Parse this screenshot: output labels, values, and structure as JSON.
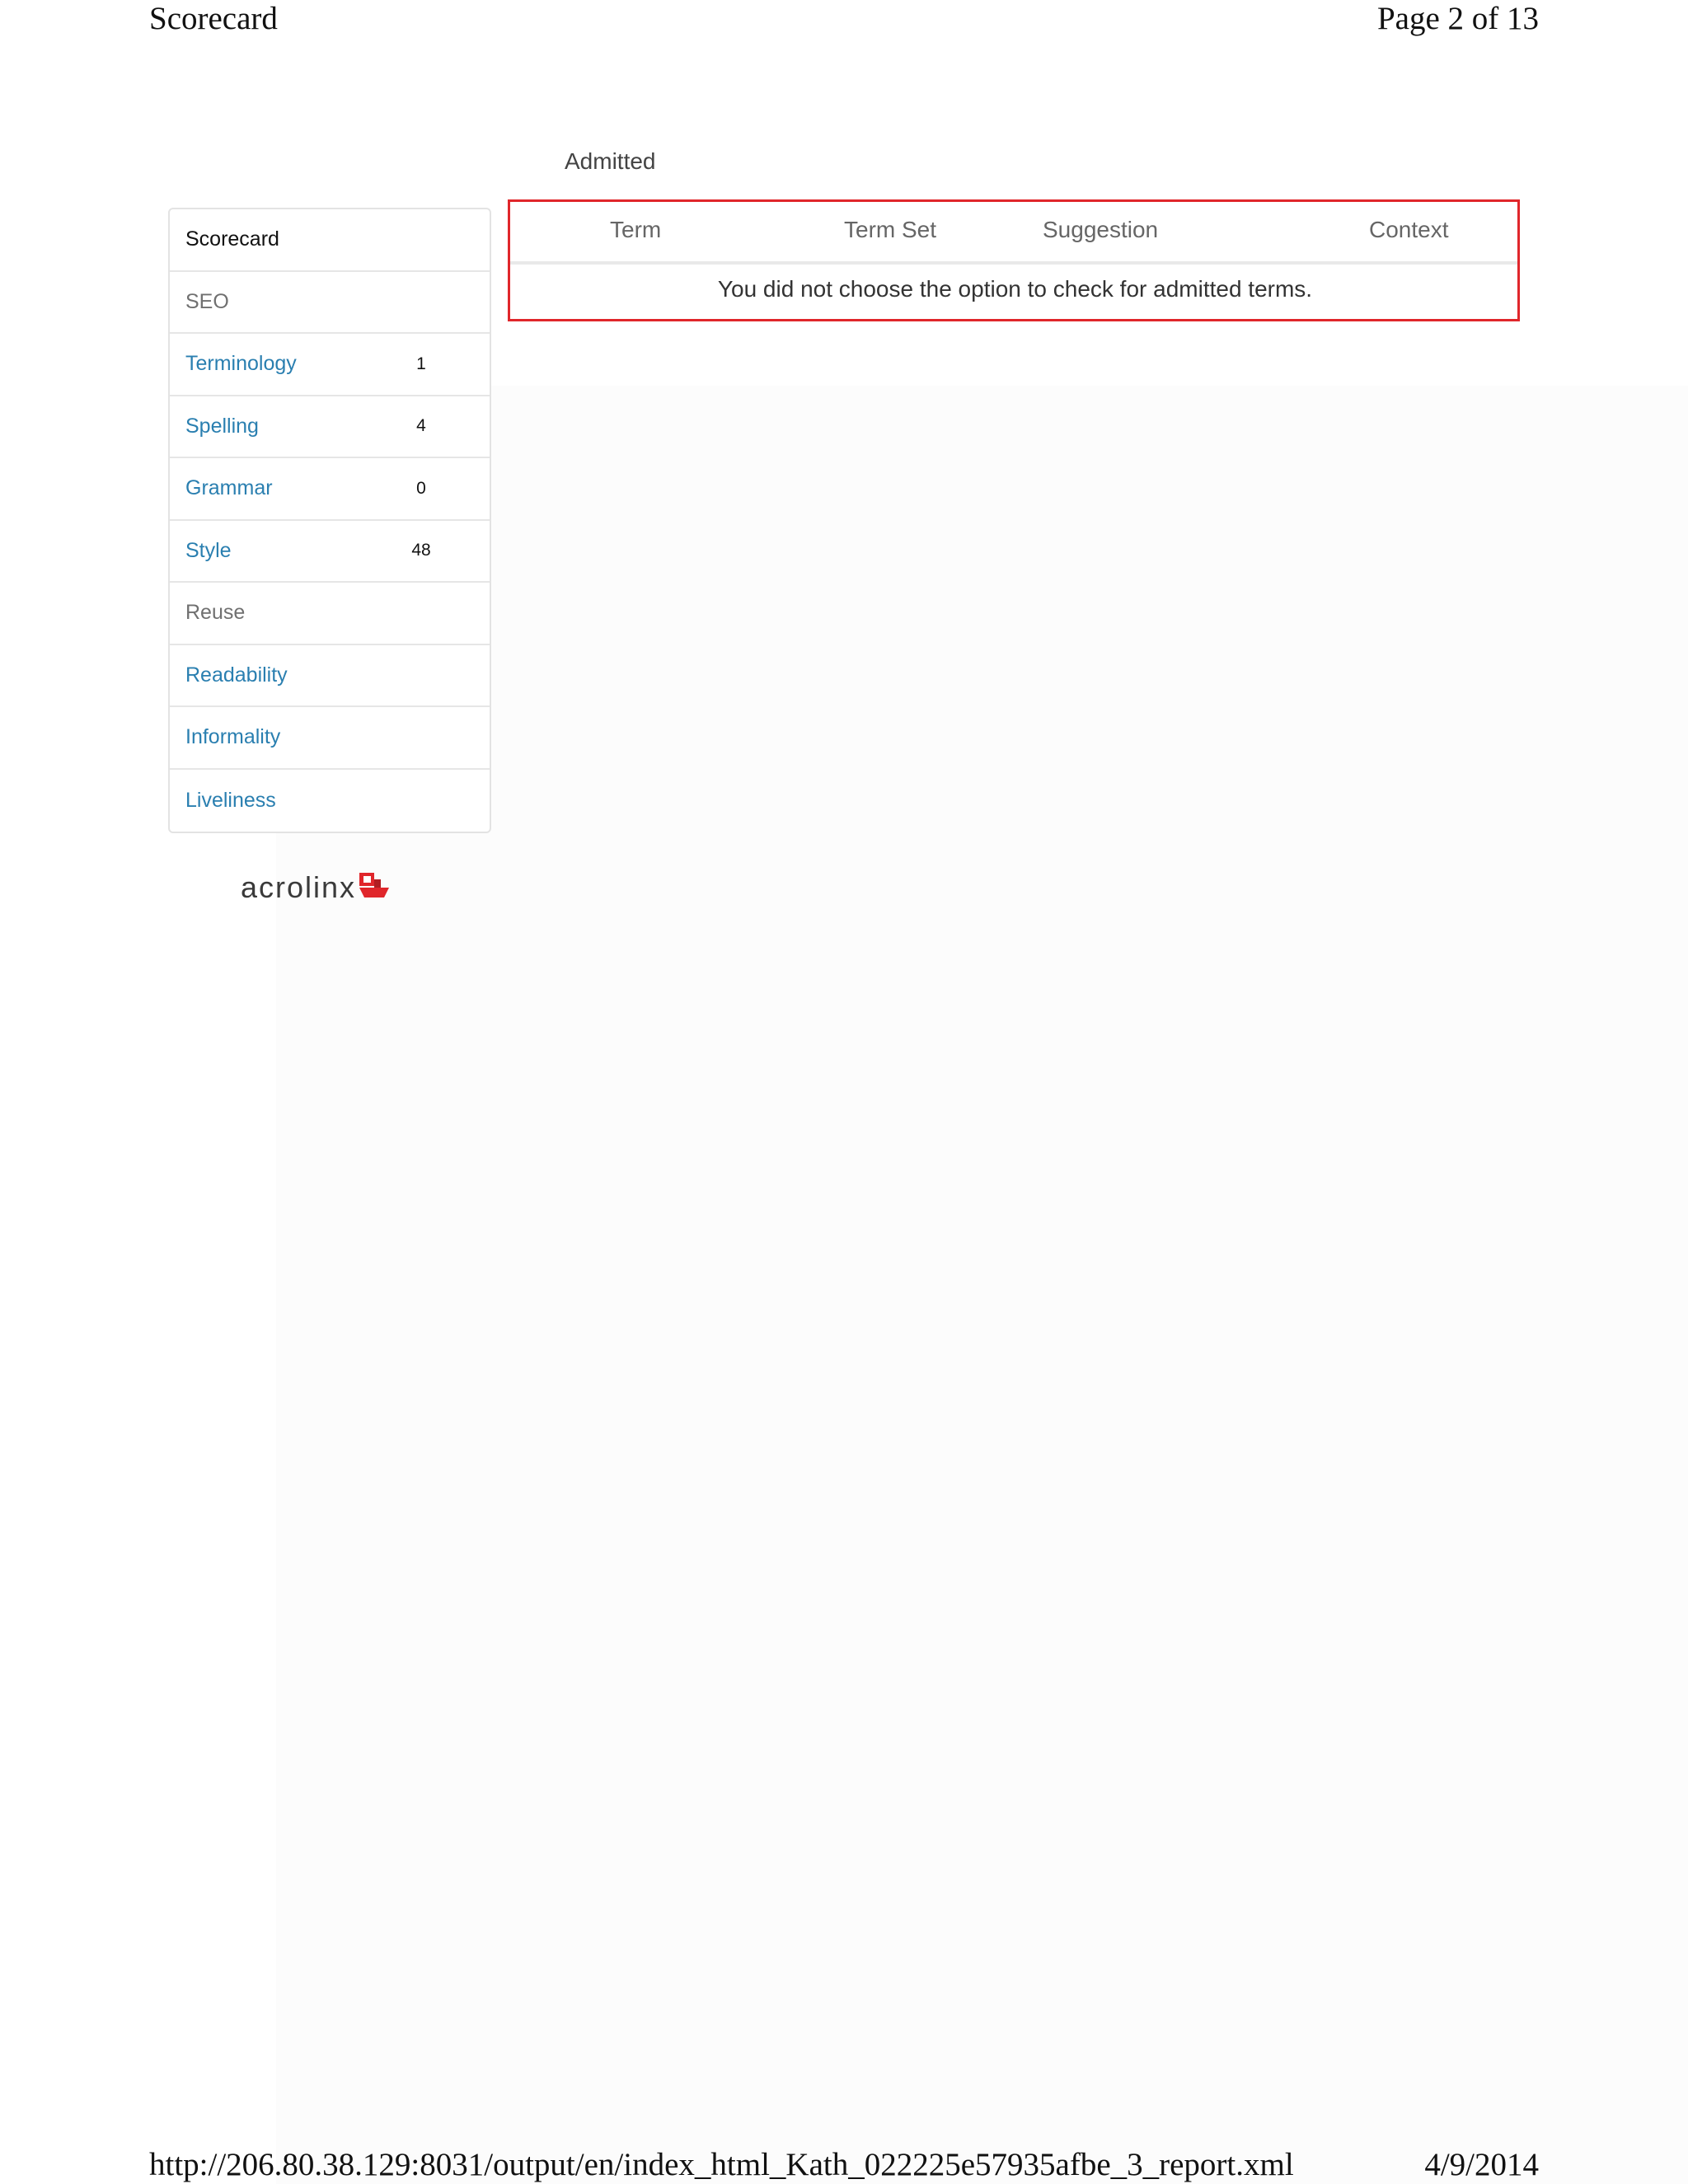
{
  "print": {
    "title": "Scorecard",
    "page": "Page 2 of 13",
    "url": "http://206.80.38.129:8031/output/en/index_html_Kath_022225e57935afbe_3_report.xml",
    "date": "4/9/2014"
  },
  "section_label": "Admitted",
  "sidebar": {
    "items": [
      {
        "label": "Scorecard",
        "count": ""
      },
      {
        "label": "SEO",
        "count": ""
      },
      {
        "label": "Terminology",
        "count": "1"
      },
      {
        "label": "Spelling",
        "count": "4"
      },
      {
        "label": "Grammar",
        "count": "0"
      },
      {
        "label": "Style",
        "count": "48"
      },
      {
        "label": "Reuse",
        "count": ""
      },
      {
        "label": "Readability",
        "count": ""
      },
      {
        "label": "Informality",
        "count": ""
      },
      {
        "label": "Liveliness",
        "count": ""
      }
    ]
  },
  "table": {
    "columns": [
      "Term",
      "Term Set",
      "Suggestion",
      "Context"
    ],
    "empty_message": "You did not choose the option to check for admitted terms."
  },
  "logo": {
    "text": "acrolinx",
    "icon": "acrolinx-logo-icon"
  },
  "colors": {
    "accent": "#e0262b",
    "link": "#2a7fb0"
  }
}
